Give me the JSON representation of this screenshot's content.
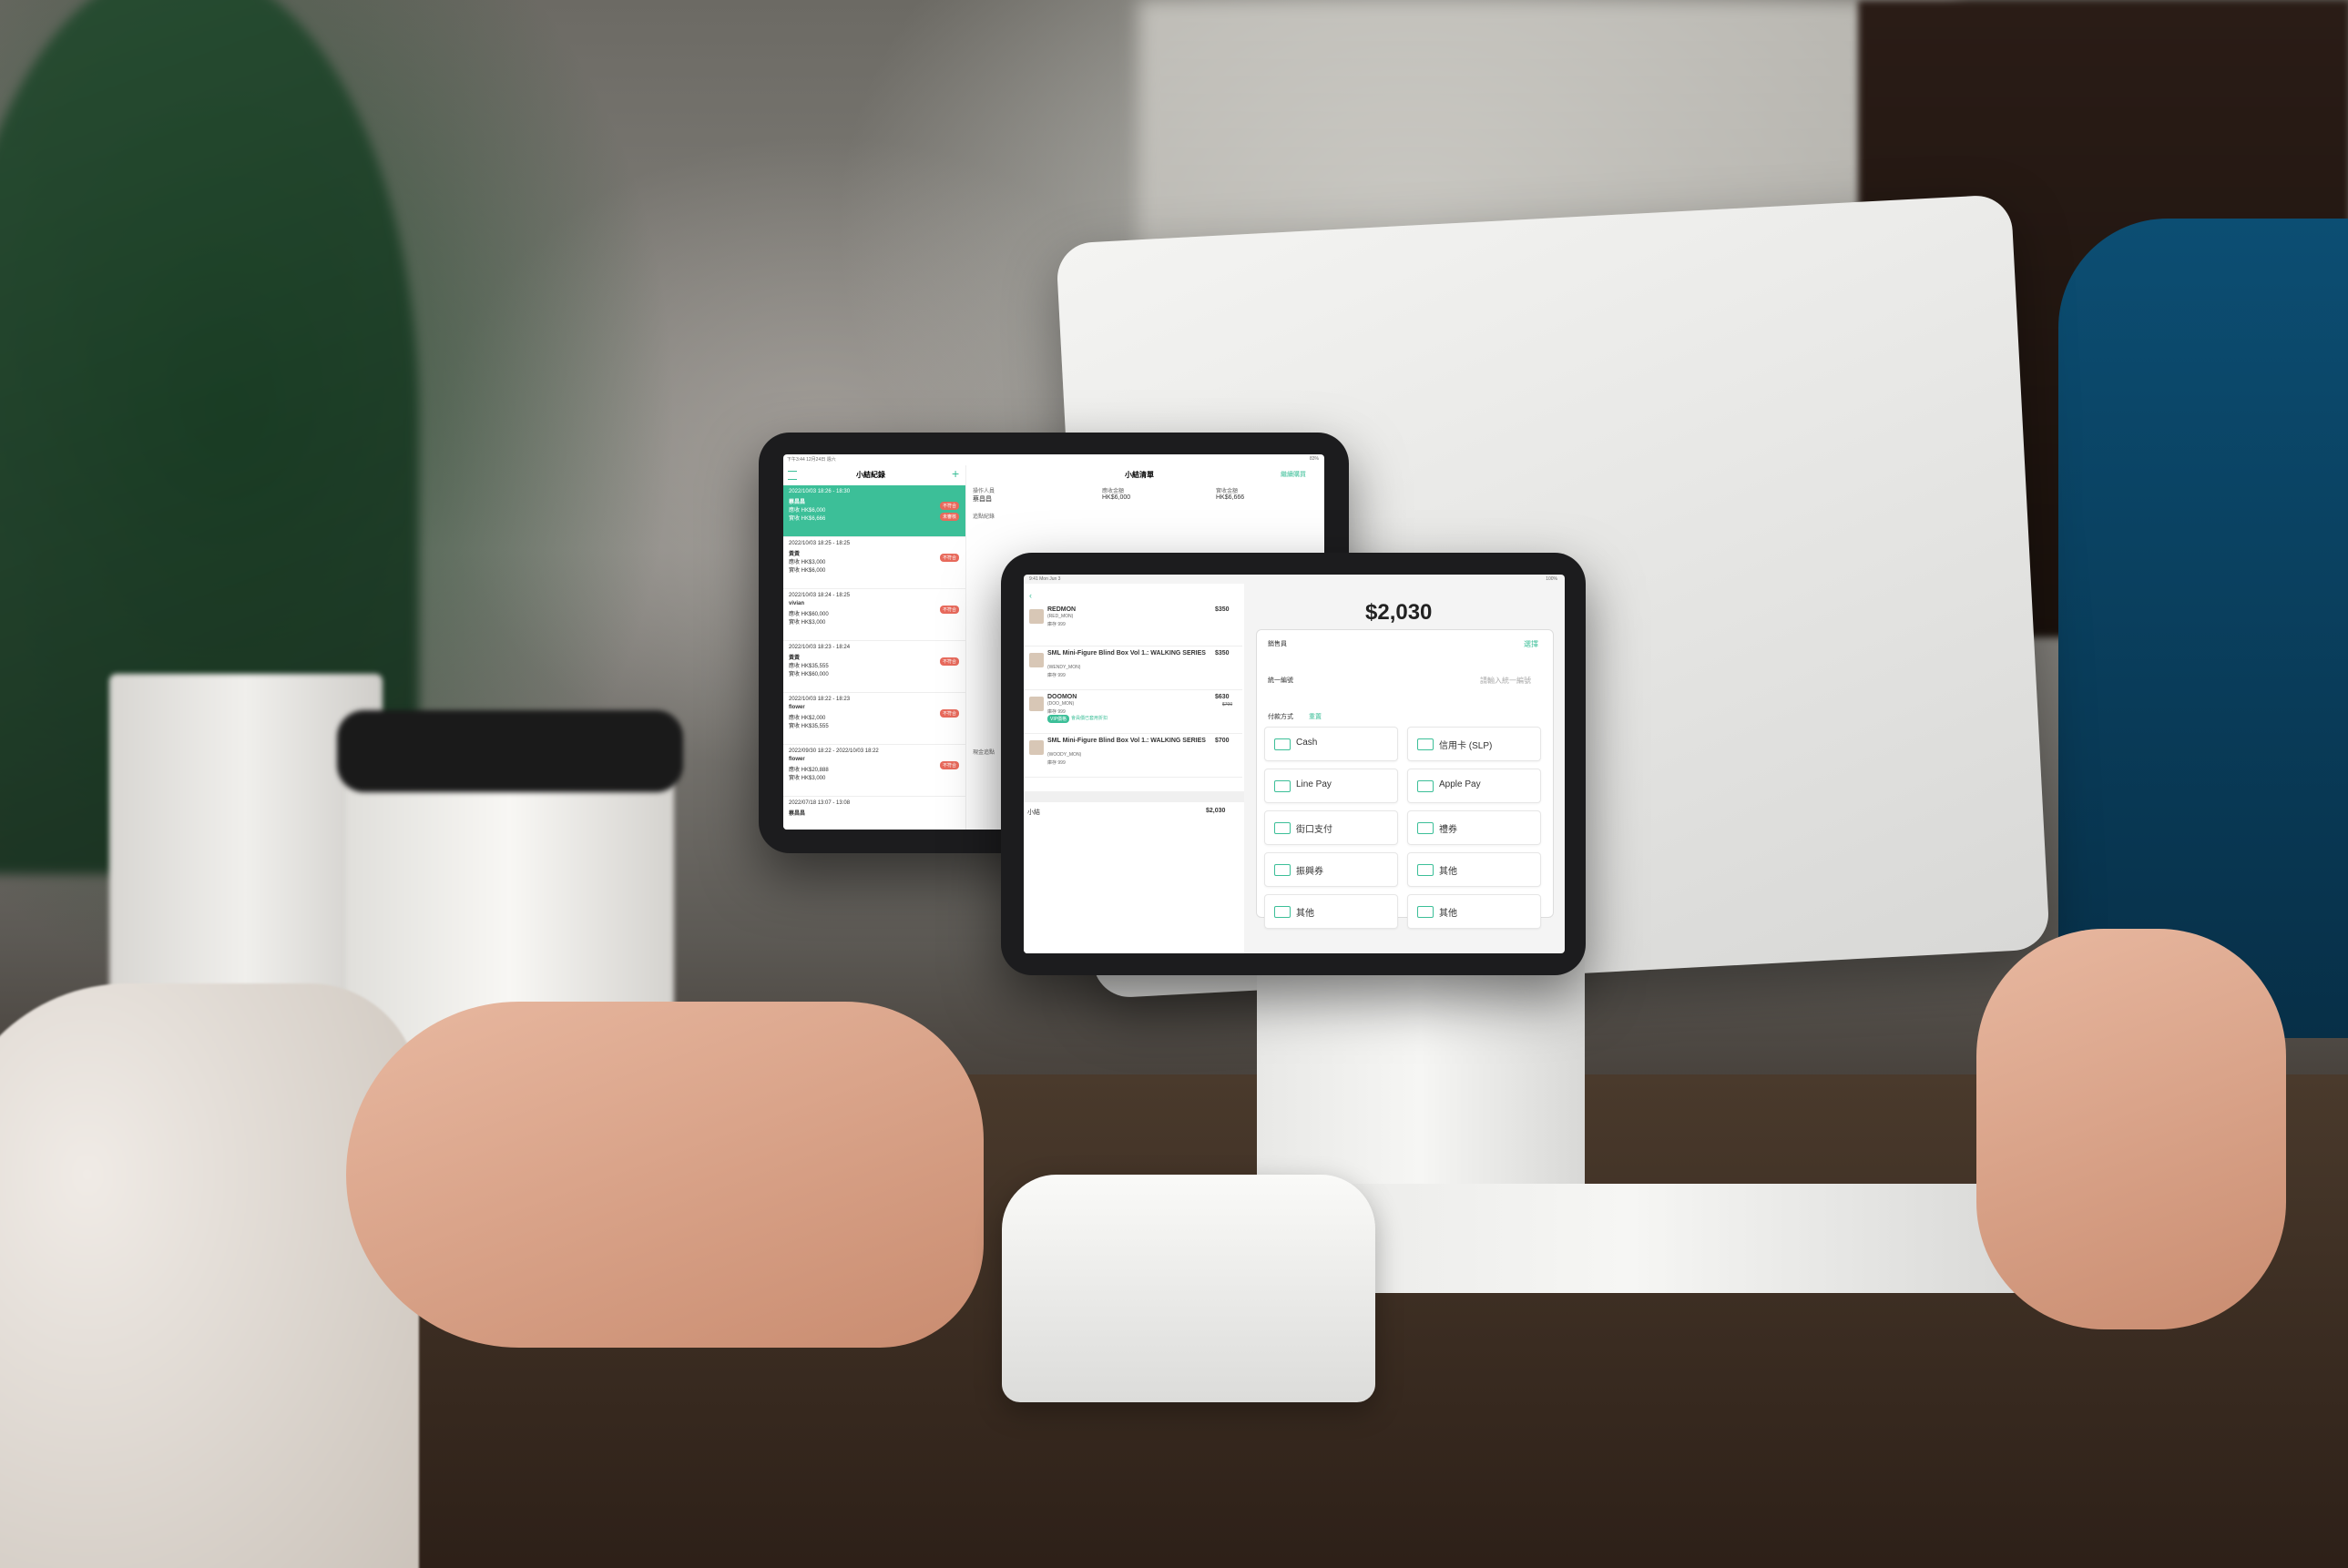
{
  "tablet_back": {
    "status_bar": "下午3:44 12月24日 週六",
    "battery": "83%",
    "left_title": "小結紀錄",
    "right_title": "小結清單",
    "action": "繼續購買",
    "summary": {
      "operator_label": "操作人員",
      "operator_value": "蔡昌昌",
      "should_label": "應收金額",
      "should_value": "HK$6,000",
      "actual_label": "實收金額",
      "actual_value": "HK$6,666"
    },
    "section_label": "追點紀錄",
    "section2_label": "現金追點",
    "records": [
      {
        "date": "2022/10/03 18:26 - 18:30",
        "name": "蔡昌昌",
        "due": "應收 HK$6,000",
        "paid": "實收 HK$6,666",
        "tags": [
          "不符合",
          "未審核"
        ]
      },
      {
        "date": "2022/10/03 18:25 - 18:25",
        "name": "黃黃",
        "due": "應收 HK$3,000",
        "paid": "實收 HK$6,000",
        "tags": [
          "不符合"
        ]
      },
      {
        "date": "2022/10/03 18:24 - 18:25",
        "name": "vivian",
        "due": "應收 HK$60,000",
        "paid": "實收 HK$3,000",
        "tags": [
          "不符合"
        ]
      },
      {
        "date": "2022/10/03 18:23 - 18:24",
        "name": "黃黃",
        "due": "應收 HK$35,555",
        "paid": "實收 HK$60,000",
        "tags": [
          "不符合"
        ]
      },
      {
        "date": "2022/10/03 18:22 - 18:23",
        "name": "flower",
        "due": "應收 HK$2,000",
        "paid": "實收 HK$35,555",
        "tags": [
          "不符合"
        ]
      },
      {
        "date": "2022/09/30 18:22 - 2022/10/03 18:22",
        "name": "flower",
        "due": "應收 HK$20,888",
        "paid": "實收 HK$3,000",
        "tags": [
          "不符合"
        ]
      },
      {
        "date": "2022/07/18 13:07 - 13:08",
        "name": "蔡昌昌",
        "due": "",
        "paid": "",
        "tags": []
      }
    ]
  },
  "tablet_front": {
    "status_time": "9:41 Mon Jun 3",
    "battery": "100%",
    "total": "$2,030",
    "items": [
      {
        "name": "REDMON",
        "sub1": "(RED_MON)",
        "sub2": "庫存 999",
        "price": "$350",
        "price_sub": "",
        "badge": "",
        "note": ""
      },
      {
        "name": "SML Mini-Figure Blind Box Vol 1.: WALKING SERIES",
        "sub1": "(WENDY_MON)",
        "sub2": "庫存 999",
        "price": "$350",
        "price_sub": "",
        "badge": "",
        "note": ""
      },
      {
        "name": "DOOMON",
        "sub1": "(DOO_MON)",
        "sub2": "庫存 999",
        "price": "$630",
        "price_sub": "$700",
        "badge": "VIP價格",
        "note": "會員價已套用折扣"
      },
      {
        "name": "SML Mini-Figure Blind Box Vol 1.: WALKING SERIES",
        "sub1": "(WOODY_MON)",
        "sub2": "庫存 999",
        "price": "$700",
        "price_sub": "",
        "badge": "",
        "note": ""
      }
    ],
    "subtotal_label": "小結",
    "subtotal_value": "$2,030",
    "salesperson_label": "銷售員",
    "salesperson_action": "選擇",
    "invoice_label": "統一編號",
    "invoice_placeholder": "請輸入統一編號",
    "payment_label": "付款方式",
    "payment_reset": "重置",
    "payments": [
      "Cash",
      "信用卡 (SLP)",
      "Line Pay",
      "Apple Pay",
      "街口支付",
      "禮券",
      "振興券",
      "其他",
      "其他",
      "其他"
    ]
  },
  "colors": {
    "accent": "#3cbf98",
    "tag": "#e86a5c"
  }
}
